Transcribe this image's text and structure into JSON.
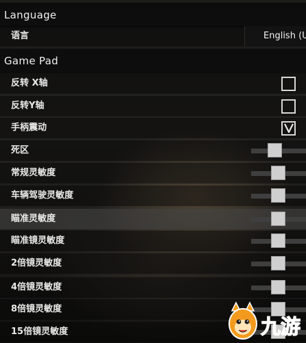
{
  "language_section": {
    "title": "Language",
    "language_label": "语言",
    "language_value": "English (U"
  },
  "gamepad_section": {
    "title": "Game Pad",
    "settings": [
      {
        "label": "反转 X轴",
        "type": "checkbox",
        "checked": false
      },
      {
        "label": "反转Y轴",
        "type": "checkbox",
        "checked": false
      },
      {
        "label": "手柄震动",
        "type": "checkbox",
        "checked": true
      },
      {
        "label": "死区",
        "type": "slider"
      },
      {
        "label": "常规灵敏度",
        "type": "slider"
      },
      {
        "label": "车辆驾驶灵敏度",
        "type": "slider"
      },
      {
        "label": "瞄准灵敏度",
        "type": "slider",
        "highlighted": true
      },
      {
        "label": "瞄准镜灵敏度",
        "type": "slider"
      },
      {
        "label": "2倍镜灵敏度",
        "type": "slider"
      },
      {
        "label": "4倍镜灵敏度",
        "type": "slider"
      },
      {
        "label": "8倍镜灵敏度",
        "type": "slider"
      },
      {
        "label": "15倍镜灵敏度",
        "type": "slider"
      }
    ]
  },
  "watermark": {
    "text": "九游",
    "mascot_icon": "orange-fox-mascot-icon",
    "brand_color": "#f39a1e"
  }
}
